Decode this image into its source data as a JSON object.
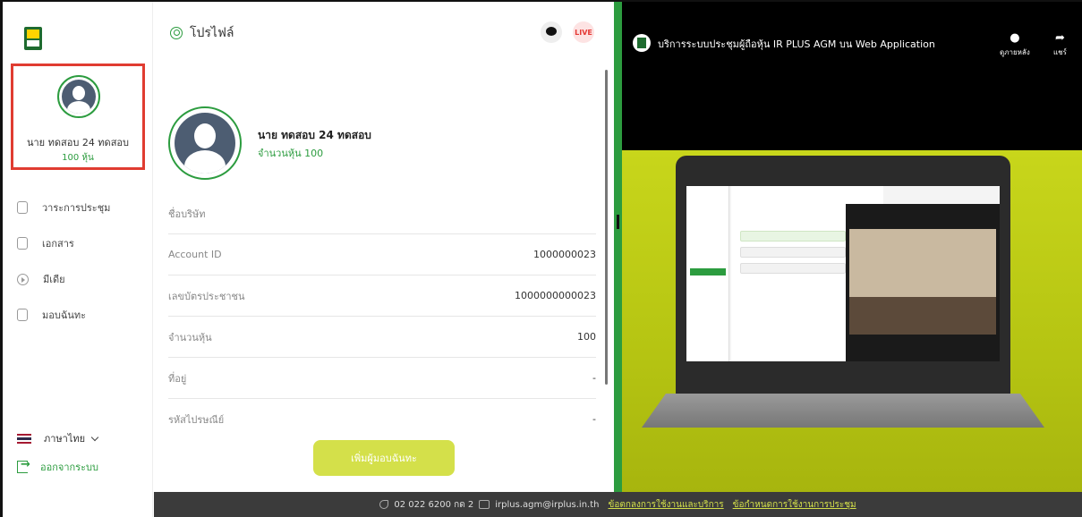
{
  "sidebar": {
    "user_name": "นาย ทดสอบ 24 ทดสอบ",
    "user_shares": "100 หุ้น",
    "menu": [
      {
        "label": "วาระการประชุม"
      },
      {
        "label": "เอกสาร"
      },
      {
        "label": "มีเดีย"
      },
      {
        "label": "มอบฉันทะ"
      }
    ],
    "language": "ภาษาไทย",
    "logout": "ออกจากระบบ"
  },
  "profile": {
    "title": "โปรไฟล์",
    "live_badge": "LIVE",
    "name": "นาย ทดสอบ 24 ทดสอบ",
    "shares": "จำนวนหุ้น 100",
    "fields": [
      {
        "label": "ชื่อบริษัท",
        "value": ""
      },
      {
        "label": "Account ID",
        "value": "1000000023"
      },
      {
        "label": "เลขบัตรประชาชน",
        "value": "1000000000023"
      },
      {
        "label": "จำนวนหุ้น",
        "value": "100"
      },
      {
        "label": "ที่อยู่",
        "value": "-"
      },
      {
        "label": "รหัสไปรษณีย์",
        "value": "-"
      }
    ],
    "add_button": "เพิ่มผู้มอบฉันทะ"
  },
  "video": {
    "title": "บริการระบบประชุมผู้ถือหุ้น IR PLUS AGM บน Web Application",
    "watch_later": "ดูภายหลัง",
    "share": "แชร์"
  },
  "footer": {
    "phone": "02 022 6200 กด 2",
    "email": "irplus.agm@irplus.in.th",
    "terms": "ข้อตกลงการใช้งานและบริการ",
    "meeting_terms": "ข้อกำหนดการใช้งานการประชุม"
  },
  "colors": {
    "accent_green": "#2c9c3f",
    "button_lime": "#d4e04a",
    "highlight_red": "#e03c31"
  }
}
